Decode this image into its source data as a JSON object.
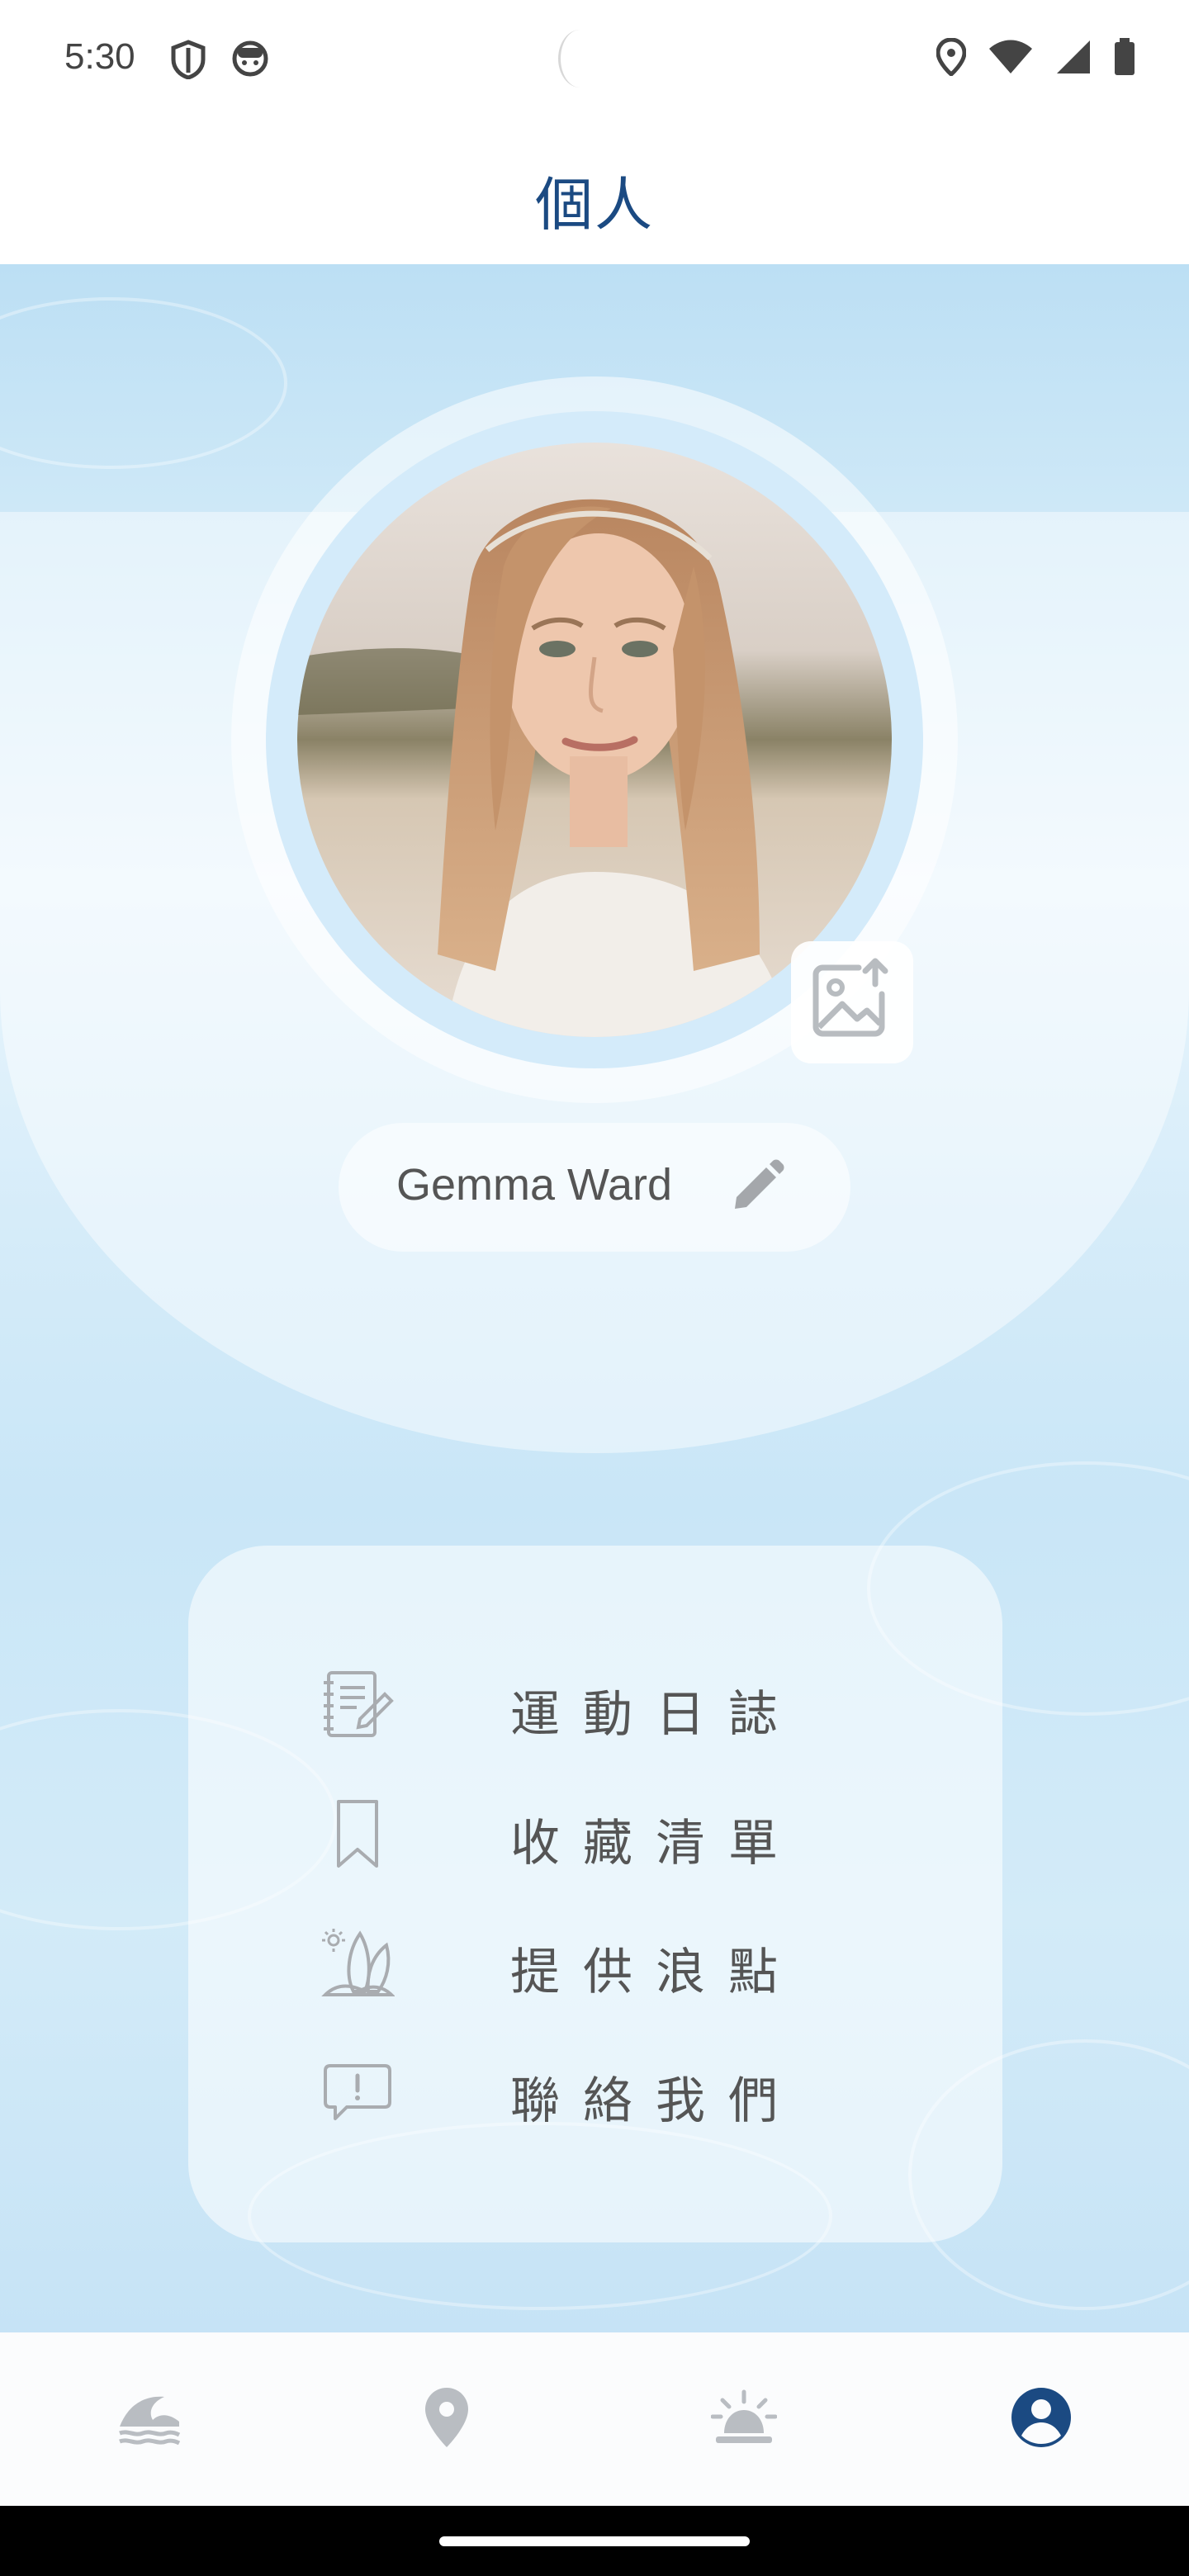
{
  "status_bar": {
    "time": "5:30",
    "left_icons": [
      "shield-icon",
      "android-face-icon"
    ],
    "right_icons": [
      "location-icon",
      "wifi-icon",
      "signal-icon",
      "battery-icon"
    ]
  },
  "header": {
    "title": "個人"
  },
  "profile": {
    "name": "Gemma Ward",
    "avatar": "portrait-photo",
    "upload_icon": "image-upload-icon",
    "edit_icon": "pencil-icon"
  },
  "menu": {
    "items": [
      {
        "label": "運動日誌",
        "icon": "notebook-edit-icon"
      },
      {
        "label": "收藏清單",
        "icon": "bookmark-icon"
      },
      {
        "label": "提供浪點",
        "icon": "surfboard-icon"
      },
      {
        "label": "聯絡我們",
        "icon": "feedback-icon"
      }
    ]
  },
  "bottom_nav": {
    "items": [
      {
        "icon": "wave-icon",
        "active": false
      },
      {
        "icon": "location-pin-icon",
        "active": false
      },
      {
        "icon": "sunrise-icon",
        "active": false
      },
      {
        "icon": "account-icon",
        "active": true
      }
    ]
  },
  "colors": {
    "title": "#1b4a82",
    "nav_active": "#1b4a82",
    "nav_inactive": "#b9bdc2",
    "menu_icon": "#a9acb0",
    "background_water": "#c9e6f7"
  }
}
